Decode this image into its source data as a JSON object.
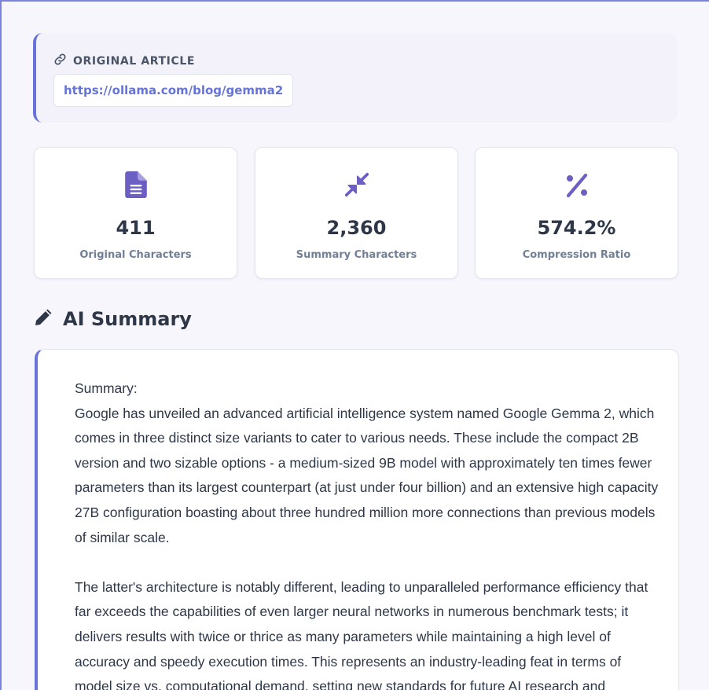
{
  "source": {
    "label": "ORIGINAL ARTICLE",
    "url": "https://ollama.com/blog/gemma2"
  },
  "stats": [
    {
      "icon": "document-icon",
      "value": "411",
      "label": "Original Characters"
    },
    {
      "icon": "compress-icon",
      "value": "2,360",
      "label": "Summary Characters"
    },
    {
      "icon": "percent-icon",
      "value": "574.2%",
      "label": "Compression Ratio"
    }
  ],
  "summary_section": {
    "title": "AI Summary",
    "text": "Summary:\nGoogle has unveiled an advanced artificial intelligence system named Google Gemma 2, which comes in three distinct size variants to cater to various needs. These include the compact 2B version and two sizable options - a medium-sized 9B model with approximately ten times fewer parameters than its largest counterpart (at just under four billion) and an extensive high capacity 27B configuration boasting about three hundred million more connections than previous models of similar scale.\n\nThe latter's architecture is notably different, leading to unparalleled performance efficiency that far exceeds the capabilities of even larger neural networks in numerous benchmark tests; it delivers results with twice or thrice as many parameters while maintaining a high level of accuracy and speedy execution times. This represents an industry-leading feat in terms of model size vs. computational demand, setting new standards for future AI research and"
  },
  "colors": {
    "accent": "#6773d8",
    "icon": "#6c5fc4",
    "background": "#f7f6fd"
  }
}
